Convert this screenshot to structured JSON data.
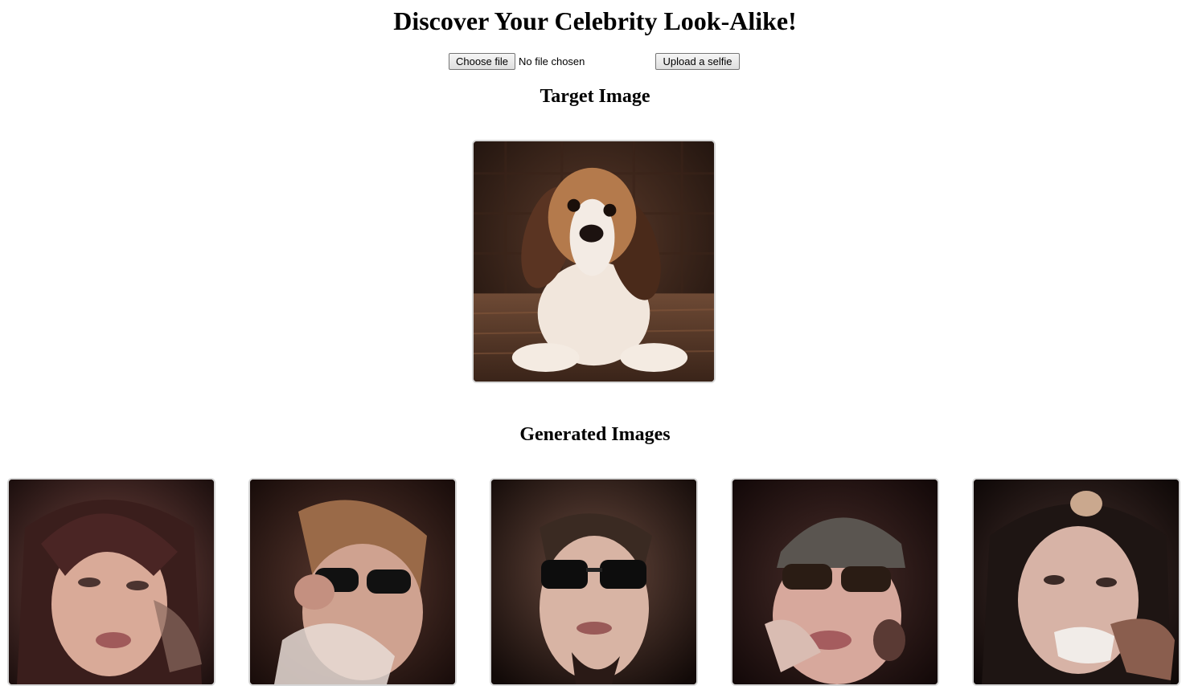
{
  "page": {
    "title": "Discover Your Celebrity Look-Alike!"
  },
  "upload": {
    "choose_file_label": "Choose file",
    "file_status": "No file chosen",
    "upload_button_label": "Upload a selfie"
  },
  "target": {
    "heading": "Target Image",
    "image_alt": "Beagle puppy lying on a patterned rug"
  },
  "generated": {
    "heading": "Generated Images",
    "images": [
      {
        "alt": "Generated face with dark hair"
      },
      {
        "alt": "Generated face with sunglasses and light hair"
      },
      {
        "alt": "Generated face with sunglasses and dark hair"
      },
      {
        "alt": "Generated face with cap and sunglasses"
      },
      {
        "alt": "Generated face with dark hair and hand"
      }
    ]
  }
}
